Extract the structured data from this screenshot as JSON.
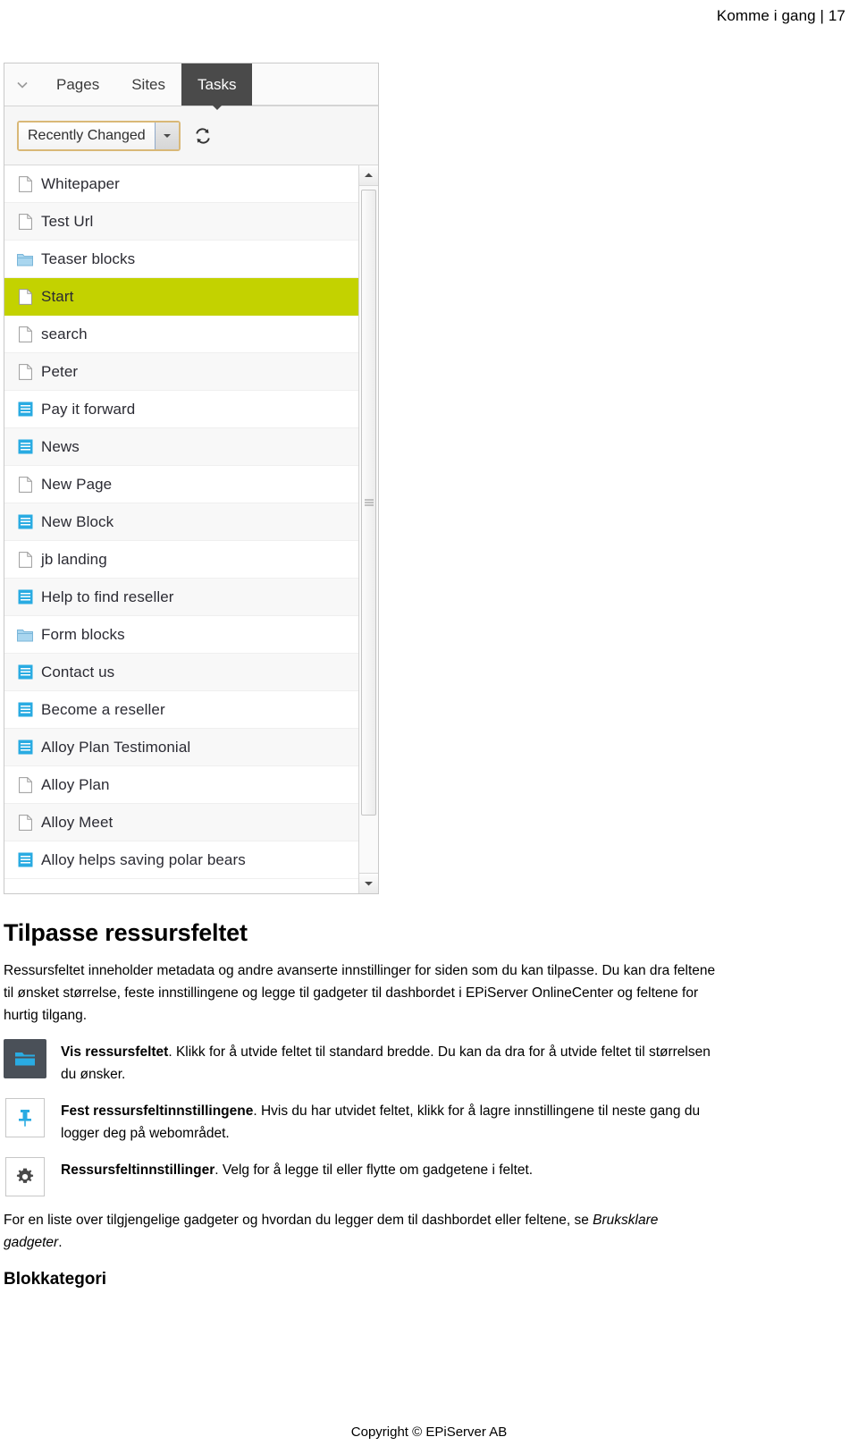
{
  "header": {
    "running_head": "Komme i gang | 17"
  },
  "screenshot": {
    "tabs": [
      {
        "label": "Pages",
        "active": false
      },
      {
        "label": "Sites",
        "active": false
      },
      {
        "label": "Tasks",
        "active": true
      }
    ],
    "collapse_icon": "chevron-down-icon",
    "toolbar": {
      "filter_value": "Recently Changed",
      "filter_arrow_icon": "caret-down-icon",
      "refresh_icon": "refresh-icon"
    },
    "scrollbar": {
      "up_icon": "scroll-up-arrow-icon",
      "down_icon": "scroll-down-arrow-icon",
      "grip_icon": "scroll-thumb-grip-icon"
    },
    "list_items": [
      {
        "label": "Whitepaper",
        "icon": "page-icon",
        "selected": false
      },
      {
        "label": "Test Url",
        "icon": "page-icon",
        "selected": false
      },
      {
        "label": "Teaser blocks",
        "icon": "folder-icon",
        "selected": false
      },
      {
        "label": "Start",
        "icon": "page-icon",
        "selected": true
      },
      {
        "label": "search",
        "icon": "page-icon",
        "selected": false
      },
      {
        "label": "Peter",
        "icon": "page-icon",
        "selected": false
      },
      {
        "label": "Pay it forward",
        "icon": "block-icon",
        "selected": false
      },
      {
        "label": "News",
        "icon": "block-icon",
        "selected": false
      },
      {
        "label": "New Page",
        "icon": "page-icon",
        "selected": false
      },
      {
        "label": "New Block",
        "icon": "block-icon",
        "selected": false
      },
      {
        "label": "jb landing",
        "icon": "page-icon",
        "selected": false
      },
      {
        "label": "Help to find reseller",
        "icon": "block-icon",
        "selected": false
      },
      {
        "label": "Form blocks",
        "icon": "folder-icon",
        "selected": false
      },
      {
        "label": "Contact us",
        "icon": "block-icon",
        "selected": false
      },
      {
        "label": "Become a reseller",
        "icon": "block-icon",
        "selected": false
      },
      {
        "label": "Alloy Plan Testimonial",
        "icon": "block-icon",
        "selected": false
      },
      {
        "label": "Alloy Plan",
        "icon": "page-icon",
        "selected": false
      },
      {
        "label": "Alloy Meet",
        "icon": "page-icon",
        "selected": false
      },
      {
        "label": "Alloy helps saving polar bears",
        "icon": "block-icon",
        "selected": false
      }
    ]
  },
  "article": {
    "title": "Tilpasse ressursfeltet",
    "intro": "Ressursfeltet inneholder metadata og andre avanserte innstillinger for siden som du kan tilpasse. Du kan dra feltene til ønsket størrelse, feste innstillingene og legge til gadgeter til dashbordet i EPiServer OnlineCenter og feltene for hurtig tilgang.",
    "features": [
      {
        "icon": "folder-panel-icon",
        "icon_style": "dark",
        "term": "Vis ressursfeltet",
        "description": ". Klikk for å utvide feltet til standard bredde. Du kan da dra for å utvide feltet til størrelsen du ønsker."
      },
      {
        "icon": "pin-icon",
        "icon_style": "light",
        "term": "Fest ressursfeltinnstillingene",
        "description": ". Hvis du har utvidet feltet, klikk for å lagre innstillingene til neste gang du logger deg på webområdet."
      },
      {
        "icon": "gear-icon",
        "icon_style": "light",
        "term": "Ressursfeltinnstillinger",
        "description": ". Velg for å legge til eller flytte om gadgetene i feltet."
      }
    ],
    "closing_prefix": "For en liste over tilgjengelige gadgeter og hvordan du legger dem til dashbordet eller feltene, se ",
    "closing_link": "Bruksklare gadgeter",
    "closing_suffix": ".",
    "subtitle": "Blokkategori"
  },
  "footer": {
    "copyright": "Copyright © EPiServer AB"
  },
  "colors": {
    "selection": "#c3d200",
    "active_tab": "#4a4a4a",
    "block_icon": "#29abe2",
    "focus_border": "#d9b877",
    "dark_icon_panel": "#4a5058"
  }
}
